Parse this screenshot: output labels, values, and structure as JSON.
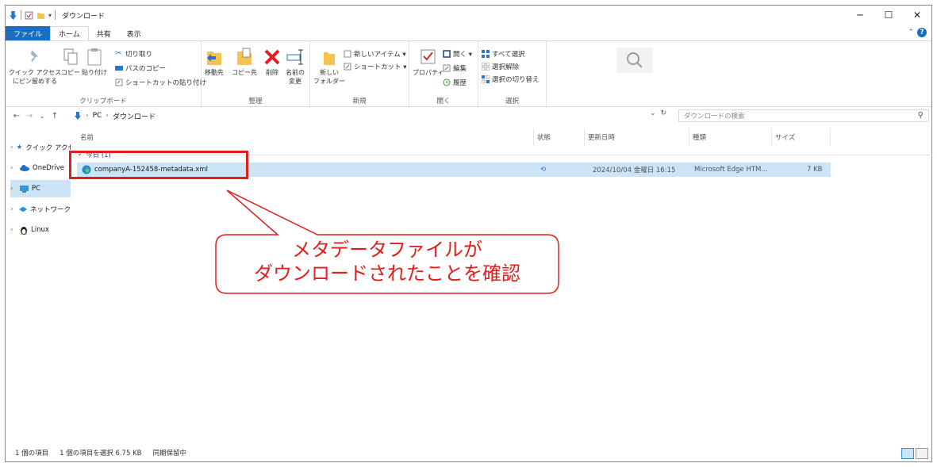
{
  "window": {
    "title": "ダウンロード",
    "controls": {
      "minimize": "─",
      "maximize": "☐",
      "close": "✕"
    }
  },
  "tabs": [
    "ファイル",
    "ホーム",
    "共有",
    "表示"
  ],
  "ribbon": {
    "clipboard": {
      "pin": "クイック アクセス\nにピン留めする",
      "copy": "コピー",
      "paste": "貼り付け",
      "cut": "切り取り",
      "copy_path": "パスのコピー",
      "paste_shortcut": "ショートカットの貼り付け",
      "label": "クリップボード"
    },
    "organize": {
      "move_to": "移動先",
      "copy_to": "コピー先",
      "delete": "削除",
      "rename": "名前の\n変更",
      "label": "整理"
    },
    "new": {
      "new_folder": "新しい\nフォルダー",
      "new_item": "新しいアイテム ▾",
      "shortcut": "ショートカット ▾",
      "label": "新規"
    },
    "open": {
      "properties": "プロパティ",
      "open": "開く ▾",
      "edit": "編集",
      "history": "履歴",
      "label": "開く"
    },
    "select": {
      "select_all": "すべて選択",
      "select_none": "選択解除",
      "invert": "選択の切り替え",
      "label": "選択"
    }
  },
  "address": {
    "path": [
      "PC",
      "ダウンロード"
    ],
    "search_placeholder": "ダウンロードの検索"
  },
  "nav": [
    {
      "label": "クイック アクセス",
      "icon": "star-icon"
    },
    {
      "label": "OneDrive",
      "icon": "cloud-icon"
    },
    {
      "label": "PC",
      "icon": "pc-icon",
      "selected": true
    },
    {
      "label": "ネットワーク",
      "icon": "network-icon"
    },
    {
      "label": "Linux",
      "icon": "linux-icon"
    }
  ],
  "columns": {
    "name": "名前",
    "status": "状態",
    "modified": "更新日時",
    "type": "種類",
    "size": "サイズ"
  },
  "group": {
    "label": "今日 (1)"
  },
  "file": {
    "name": "companyA-152458-metadata.xml",
    "status_icon": "sync-icon",
    "modified": "2024/10/04 金曜日 16:15",
    "type": "Microsoft Edge HTM...",
    "size": "7 KB"
  },
  "annotation": {
    "line1": "メタデータファイルが",
    "line2": "ダウンロードされたことを確認",
    "color": "#e31c1c"
  },
  "status": {
    "count": "1 個の項目",
    "selected": "1 個の項目を選択 6.75 KB",
    "sync": "同期保留中"
  }
}
